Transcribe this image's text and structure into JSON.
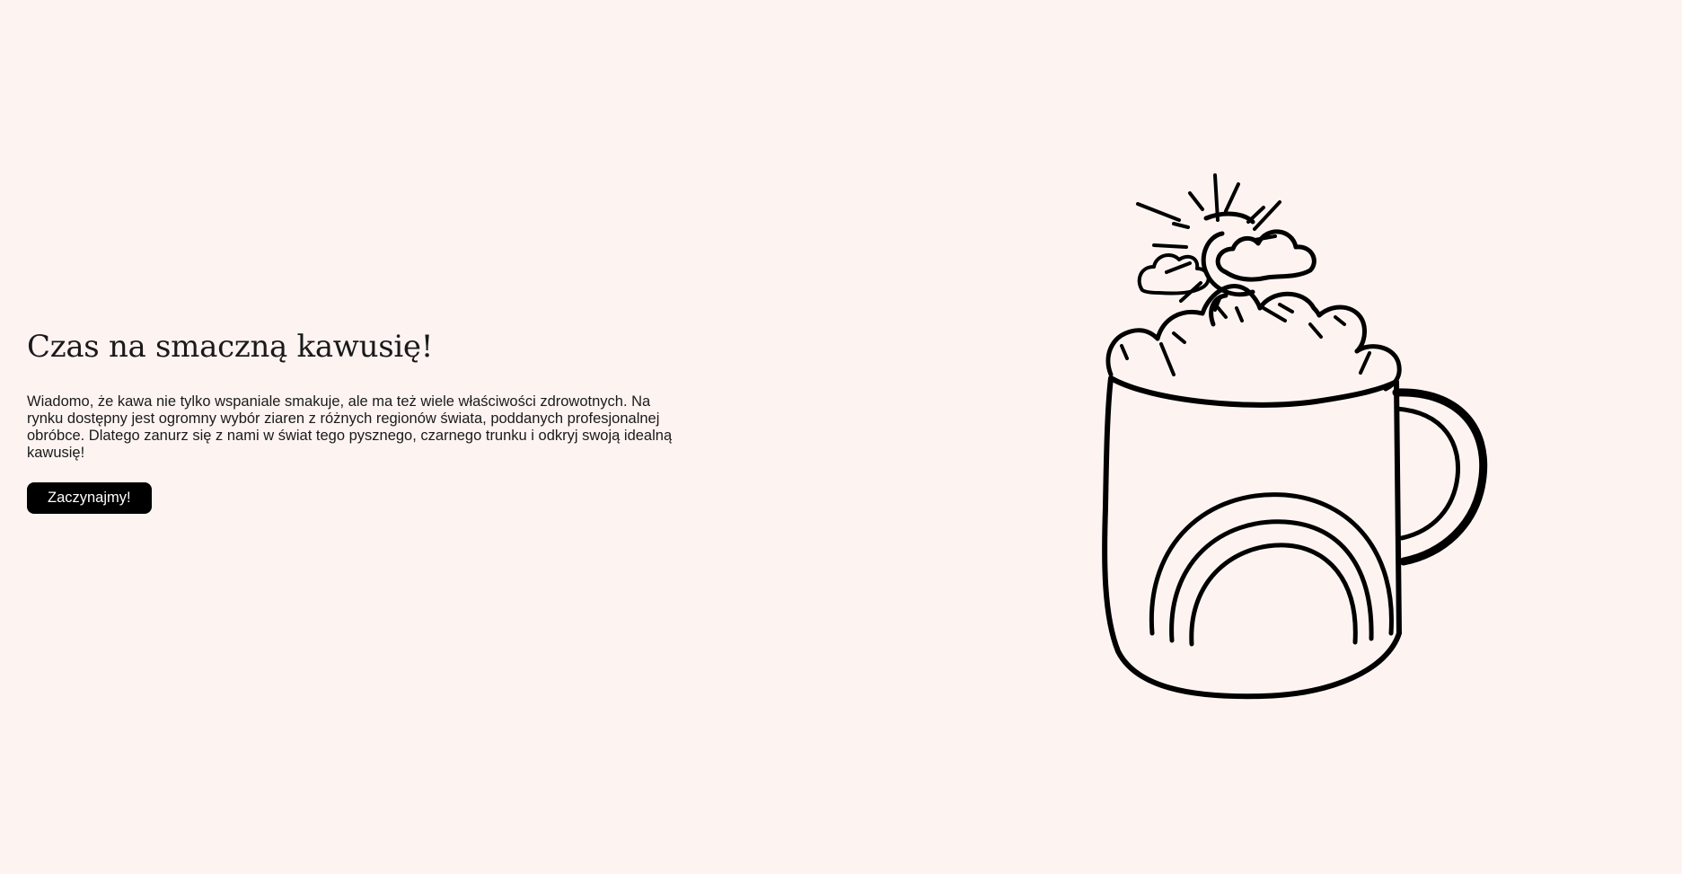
{
  "hero": {
    "title": "Czas na smaczną kawusię!",
    "description": "Wiadomo, że kawa nie tylko wspaniale smakuje, ale ma też wiele właściwości zdrowotnych. Na rynku dostępny jest ogromny wybór ziaren z różnych regionów świata, poddanych profesjonalnej obróbce. Dlatego zanurz się z nami w świat tego pysznego, czarnego trunku i odkryj swoją idealną kawusię!",
    "button_label": "Zaczynajmy!"
  },
  "illustration": {
    "icon": "coffee-cup-with-sun-and-clouds"
  },
  "colors": {
    "background": "#fdf4f2",
    "text": "#1a1a1a",
    "button_bg": "#000000",
    "button_text": "#ffffff"
  }
}
